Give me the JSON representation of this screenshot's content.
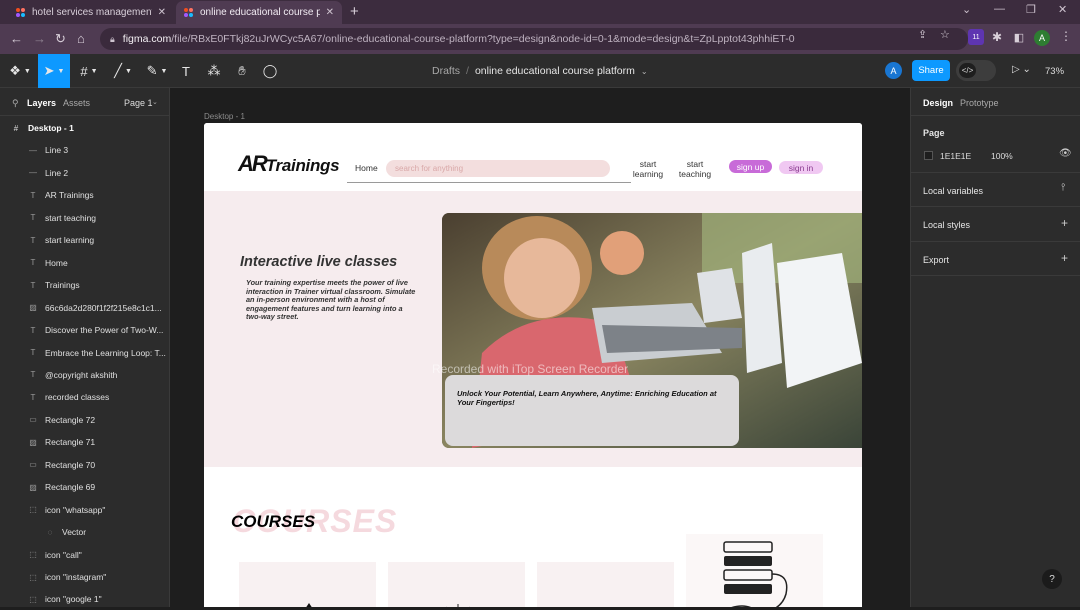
{
  "browser": {
    "tabs": [
      {
        "title": "hotel services management syste",
        "active": false
      },
      {
        "title": "online educational course platfor",
        "active": true
      }
    ],
    "url_domain": "figma.com",
    "url_rest": "/file/RBxE0FTkj82uJrWCyc5A67/online-educational-course-platform?type=design&node-id=0-1&mode=design&t=ZpLpptot43phhiET-0",
    "new_tab": "+",
    "profile_initial": "A",
    "ext_badge": "11"
  },
  "toolbar": {
    "breadcrumb_drafts": "Drafts",
    "breadcrumb_sep": "/",
    "file_name": "online educational course platform",
    "avatar": "A",
    "share_label": "Share",
    "zoom": "73%"
  },
  "layers_panel": {
    "tab_layers": "Layers",
    "tab_assets": "Assets",
    "page": "Page 1",
    "items": [
      {
        "icon": "#",
        "label": "Desktop - 1",
        "indent": 0
      },
      {
        "icon": "—",
        "label": "Line 3",
        "indent": 1
      },
      {
        "icon": "—",
        "label": "Line 2",
        "indent": 1
      },
      {
        "icon": "T",
        "label": "AR Trainings",
        "indent": 1
      },
      {
        "icon": "T",
        "label": "start teaching",
        "indent": 1
      },
      {
        "icon": "T",
        "label": "start learning",
        "indent": 1
      },
      {
        "icon": "T",
        "label": "Home",
        "indent": 1
      },
      {
        "icon": "T",
        "label": "Trainings",
        "indent": 1
      },
      {
        "icon": "▨",
        "label": "66c6da2d280f1f2f215e8c1c1...",
        "indent": 1
      },
      {
        "icon": "T",
        "label": "Discover the Power of Two-W...",
        "indent": 1
      },
      {
        "icon": "T",
        "label": "Embrace the Learning Loop: T...",
        "indent": 1
      },
      {
        "icon": "T",
        "label": "@copyright akshith",
        "indent": 1
      },
      {
        "icon": "T",
        "label": "recorded classes",
        "indent": 1
      },
      {
        "icon": "▭",
        "label": "Rectangle 72",
        "indent": 1
      },
      {
        "icon": "▨",
        "label": "Rectangle 71",
        "indent": 1
      },
      {
        "icon": "▭",
        "label": "Rectangle 70",
        "indent": 1
      },
      {
        "icon": "▨",
        "label": "Rectangle 69",
        "indent": 1
      },
      {
        "icon": "⬚",
        "label": "icon \"whatsapp\"",
        "indent": 1
      },
      {
        "icon": "◌",
        "label": "Vector",
        "indent": 2
      },
      {
        "icon": "⬚",
        "label": "icon \"call\"",
        "indent": 1
      },
      {
        "icon": "⬚",
        "label": "icon \"instagram\"",
        "indent": 1
      },
      {
        "icon": "⬚",
        "label": "icon \"google 1\"",
        "indent": 1
      }
    ]
  },
  "canvas": {
    "frame_label": "Desktop - 1",
    "site": {
      "logo_ar": "AR",
      "logo_text": "Trainings",
      "nav_home": "Home",
      "search_placeholder": "search for anything",
      "nav_start_learning": "start learning",
      "nav_start_teaching": "start teaching",
      "btn_signup": "sign up",
      "btn_signin": "sign in",
      "hero_title": "Interactive live classes",
      "hero_text": "Your training expertise meets the power of live interaction in Trainer virtual classroom. Simulate an in-person environment with a host of engagement features and turn learning into a two-way street.",
      "hero_card": "Unlock Your Potential, Learn Anywhere, Anytime: Enriching Education at Your Fingertips!",
      "watermark": "Recorded with iTop Screen Recorder",
      "courses_ghost": "COURSES",
      "courses": "COURSES"
    }
  },
  "right_panel": {
    "tab_design": "Design",
    "tab_prototype": "Prototype",
    "page_heading": "Page",
    "page_color_hex": "1E1E1E",
    "page_opacity": "100%",
    "local_variables": "Local variables",
    "local_styles": "Local styles",
    "export": "Export"
  },
  "help": "?",
  "colors": {
    "accent": "#0d99ff",
    "signup_pill": "#c86bd8",
    "signin_pill": "#f0c8f2",
    "search_pill": "#f3dede",
    "hero_bg": "#f6ecee"
  }
}
